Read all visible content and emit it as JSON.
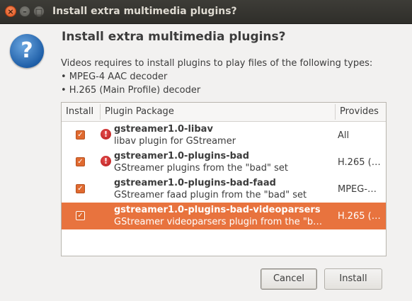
{
  "window": {
    "title": "Install extra multimedia plugins?"
  },
  "dialog": {
    "icon": "question-icon",
    "heading": "Install extra multimedia plugins?",
    "description": [
      "Videos requires to install plugins to play files of the following types:",
      "• MPEG-4 AAC decoder",
      "• H.265 (Main Profile) decoder"
    ]
  },
  "table": {
    "columns": [
      "Install",
      "Plugin Package",
      "Provides"
    ],
    "rows": [
      {
        "checked": true,
        "error": true,
        "name": "gstreamer1.0-libav",
        "desc": "libav plugin for GStreamer",
        "provides": "All",
        "selected": false
      },
      {
        "checked": true,
        "error": true,
        "name": "gstreamer1.0-plugins-bad",
        "desc": "GStreamer plugins from the \"bad\" set",
        "provides": "H.265 (…",
        "selected": false
      },
      {
        "checked": true,
        "error": false,
        "name": "gstreamer1.0-plugins-bad-faad",
        "desc": "GStreamer faad plugin from the \"bad\" set",
        "provides": "MPEG-…",
        "selected": false
      },
      {
        "checked": true,
        "error": false,
        "name": "gstreamer1.0-plugins-bad-videoparsers",
        "desc": "GStreamer videoparsers plugin from the \"b…",
        "provides": "H.265 (…",
        "selected": true
      }
    ]
  },
  "buttons": {
    "cancel": "Cancel",
    "install": "Install"
  },
  "colors": {
    "accent": "#e8733e",
    "titlebar": "#3d3c37",
    "error": "#c62020"
  }
}
